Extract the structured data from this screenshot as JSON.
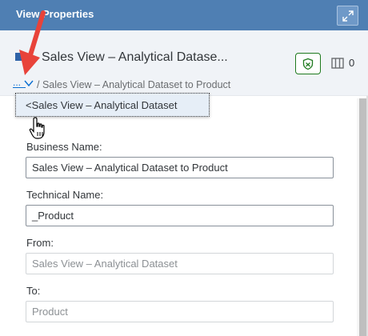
{
  "header": {
    "title": "View Properties"
  },
  "subheader": {
    "view_title": "Sales View – Analytical Datase...",
    "columns_count": "0",
    "breadcrumb_ellipsis": "...",
    "breadcrumb_text": "/ Sales View – Analytical Dataset to Product"
  },
  "dropdown": {
    "item": "<Sales View – Analytical Dataset"
  },
  "form": {
    "business_name_label": "Business Name:",
    "business_name_value": "Sales View – Analytical Dataset to Product",
    "technical_name_label": "Technical Name:",
    "technical_name_value": "_Product",
    "from_label": "From:",
    "from_value": "Sales View – Analytical Dataset",
    "to_label": "To:",
    "to_value": "Product"
  },
  "icons": {
    "expand": "expand-icon",
    "view": "view-icon",
    "status": "shield-check-icon",
    "columns": "columns-icon",
    "chevron": "chevron-down-icon",
    "cursor": "hand-cursor-icon"
  },
  "colors": {
    "header_bg": "#4f7fb3",
    "subheader_bg": "#f0f3f7",
    "link": "#0a6ed1",
    "status_green": "#1f7a1f",
    "annotation_red": "#e8433a",
    "dropdown_bg": "#e6eef7"
  }
}
